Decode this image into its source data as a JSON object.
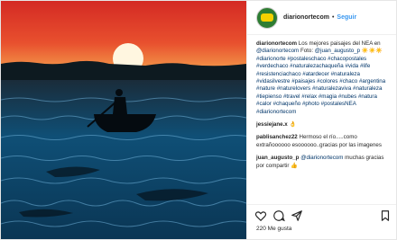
{
  "header": {
    "username": "diarionortecom",
    "separator": "•",
    "follow_label": "Seguir"
  },
  "caption": {
    "user": "diarionortecom",
    "text_1": "Los mejores paisajes del NEA en",
    "mention_1": "@diarionortecom",
    "photo_label": "Foto:",
    "mention_2": "@juan_augusto_p",
    "hashtags": [
      "#diarionorte",
      "#postaleschaco",
      "#chacopostales",
      "#verdechaco",
      "#naturalezachaqueña",
      "#vida",
      "#life",
      "#resistenciachaco",
      "#atardecer",
      "#naturaleza",
      "#vidasilvestre",
      "#paisajes",
      "#colores",
      "#chaco",
      "#argentina",
      "#nature",
      "#naturelovers",
      "#naturalezaviva",
      "#naturaleza",
      "#tiepienso",
      "#travel",
      "#relax",
      "#magia",
      "#nubes",
      "#natura",
      "#calor",
      "#chaqueño",
      "#photo",
      "#postalesNEA",
      "#diarionortecom"
    ]
  },
  "comments": [
    {
      "user": "jessiejane.x",
      "text": "👌"
    },
    {
      "user": "pablisanchez22",
      "text": "Hermoso el río.....como extrañoooooo esoooooo..gracias por las imagenes"
    },
    {
      "user": "juan_augusto_p",
      "mention": "@diarionortecom",
      "text": "muchas gracias por compartir 👍"
    }
  ],
  "actions": {
    "like_icon": "heart-icon",
    "comment_icon": "comment-icon",
    "share_icon": "share-icon",
    "save_icon": "bookmark-icon"
  },
  "likes": "220 Me gusta",
  "colors": {
    "link": "#003569",
    "follow": "#3897f0",
    "sky_top": "#d8322a",
    "sky_bottom": "#f07a3a",
    "water": "#0b3a5c"
  }
}
